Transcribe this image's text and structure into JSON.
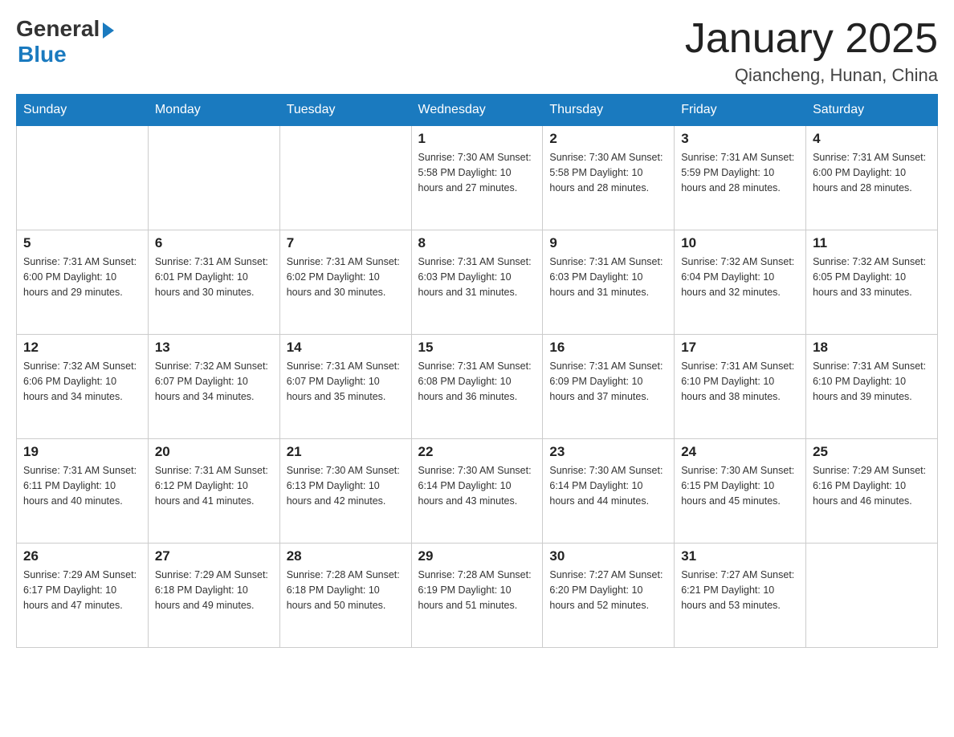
{
  "header": {
    "logo_general": "General",
    "logo_blue": "Blue",
    "month_title": "January 2025",
    "location": "Qiancheng, Hunan, China"
  },
  "days_of_week": [
    "Sunday",
    "Monday",
    "Tuesday",
    "Wednesday",
    "Thursday",
    "Friday",
    "Saturday"
  ],
  "weeks": [
    [
      {
        "day": "",
        "info": ""
      },
      {
        "day": "",
        "info": ""
      },
      {
        "day": "",
        "info": ""
      },
      {
        "day": "1",
        "info": "Sunrise: 7:30 AM\nSunset: 5:58 PM\nDaylight: 10 hours\nand 27 minutes."
      },
      {
        "day": "2",
        "info": "Sunrise: 7:30 AM\nSunset: 5:58 PM\nDaylight: 10 hours\nand 28 minutes."
      },
      {
        "day": "3",
        "info": "Sunrise: 7:31 AM\nSunset: 5:59 PM\nDaylight: 10 hours\nand 28 minutes."
      },
      {
        "day": "4",
        "info": "Sunrise: 7:31 AM\nSunset: 6:00 PM\nDaylight: 10 hours\nand 28 minutes."
      }
    ],
    [
      {
        "day": "5",
        "info": "Sunrise: 7:31 AM\nSunset: 6:00 PM\nDaylight: 10 hours\nand 29 minutes."
      },
      {
        "day": "6",
        "info": "Sunrise: 7:31 AM\nSunset: 6:01 PM\nDaylight: 10 hours\nand 30 minutes."
      },
      {
        "day": "7",
        "info": "Sunrise: 7:31 AM\nSunset: 6:02 PM\nDaylight: 10 hours\nand 30 minutes."
      },
      {
        "day": "8",
        "info": "Sunrise: 7:31 AM\nSunset: 6:03 PM\nDaylight: 10 hours\nand 31 minutes."
      },
      {
        "day": "9",
        "info": "Sunrise: 7:31 AM\nSunset: 6:03 PM\nDaylight: 10 hours\nand 31 minutes."
      },
      {
        "day": "10",
        "info": "Sunrise: 7:32 AM\nSunset: 6:04 PM\nDaylight: 10 hours\nand 32 minutes."
      },
      {
        "day": "11",
        "info": "Sunrise: 7:32 AM\nSunset: 6:05 PM\nDaylight: 10 hours\nand 33 minutes."
      }
    ],
    [
      {
        "day": "12",
        "info": "Sunrise: 7:32 AM\nSunset: 6:06 PM\nDaylight: 10 hours\nand 34 minutes."
      },
      {
        "day": "13",
        "info": "Sunrise: 7:32 AM\nSunset: 6:07 PM\nDaylight: 10 hours\nand 34 minutes."
      },
      {
        "day": "14",
        "info": "Sunrise: 7:31 AM\nSunset: 6:07 PM\nDaylight: 10 hours\nand 35 minutes."
      },
      {
        "day": "15",
        "info": "Sunrise: 7:31 AM\nSunset: 6:08 PM\nDaylight: 10 hours\nand 36 minutes."
      },
      {
        "day": "16",
        "info": "Sunrise: 7:31 AM\nSunset: 6:09 PM\nDaylight: 10 hours\nand 37 minutes."
      },
      {
        "day": "17",
        "info": "Sunrise: 7:31 AM\nSunset: 6:10 PM\nDaylight: 10 hours\nand 38 minutes."
      },
      {
        "day": "18",
        "info": "Sunrise: 7:31 AM\nSunset: 6:10 PM\nDaylight: 10 hours\nand 39 minutes."
      }
    ],
    [
      {
        "day": "19",
        "info": "Sunrise: 7:31 AM\nSunset: 6:11 PM\nDaylight: 10 hours\nand 40 minutes."
      },
      {
        "day": "20",
        "info": "Sunrise: 7:31 AM\nSunset: 6:12 PM\nDaylight: 10 hours\nand 41 minutes."
      },
      {
        "day": "21",
        "info": "Sunrise: 7:30 AM\nSunset: 6:13 PM\nDaylight: 10 hours\nand 42 minutes."
      },
      {
        "day": "22",
        "info": "Sunrise: 7:30 AM\nSunset: 6:14 PM\nDaylight: 10 hours\nand 43 minutes."
      },
      {
        "day": "23",
        "info": "Sunrise: 7:30 AM\nSunset: 6:14 PM\nDaylight: 10 hours\nand 44 minutes."
      },
      {
        "day": "24",
        "info": "Sunrise: 7:30 AM\nSunset: 6:15 PM\nDaylight: 10 hours\nand 45 minutes."
      },
      {
        "day": "25",
        "info": "Sunrise: 7:29 AM\nSunset: 6:16 PM\nDaylight: 10 hours\nand 46 minutes."
      }
    ],
    [
      {
        "day": "26",
        "info": "Sunrise: 7:29 AM\nSunset: 6:17 PM\nDaylight: 10 hours\nand 47 minutes."
      },
      {
        "day": "27",
        "info": "Sunrise: 7:29 AM\nSunset: 6:18 PM\nDaylight: 10 hours\nand 49 minutes."
      },
      {
        "day": "28",
        "info": "Sunrise: 7:28 AM\nSunset: 6:18 PM\nDaylight: 10 hours\nand 50 minutes."
      },
      {
        "day": "29",
        "info": "Sunrise: 7:28 AM\nSunset: 6:19 PM\nDaylight: 10 hours\nand 51 minutes."
      },
      {
        "day": "30",
        "info": "Sunrise: 7:27 AM\nSunset: 6:20 PM\nDaylight: 10 hours\nand 52 minutes."
      },
      {
        "day": "31",
        "info": "Sunrise: 7:27 AM\nSunset: 6:21 PM\nDaylight: 10 hours\nand 53 minutes."
      },
      {
        "day": "",
        "info": ""
      }
    ]
  ]
}
